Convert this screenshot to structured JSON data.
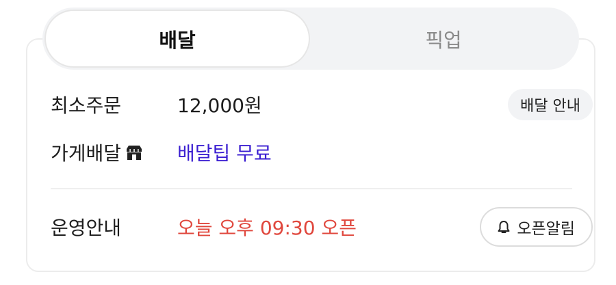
{
  "tabs": [
    {
      "label": "배달",
      "active": true
    },
    {
      "label": "픽업",
      "active": false
    }
  ],
  "info": {
    "min_order": {
      "label": "최소주문",
      "value": "12,000원",
      "button": "배달 안내"
    },
    "store_delivery": {
      "label": "가게배달",
      "icon": "store-icon",
      "value": "배달팁 무료"
    },
    "hours": {
      "label": "운영안내",
      "value": "오늘 오후 09:30 오픈",
      "button": "오픈알림",
      "button_icon": "bell-icon"
    }
  },
  "colors": {
    "accent_purple": "#3b1fd1",
    "status_red": "#e0473d",
    "tab_bg": "#f2f3f5"
  }
}
